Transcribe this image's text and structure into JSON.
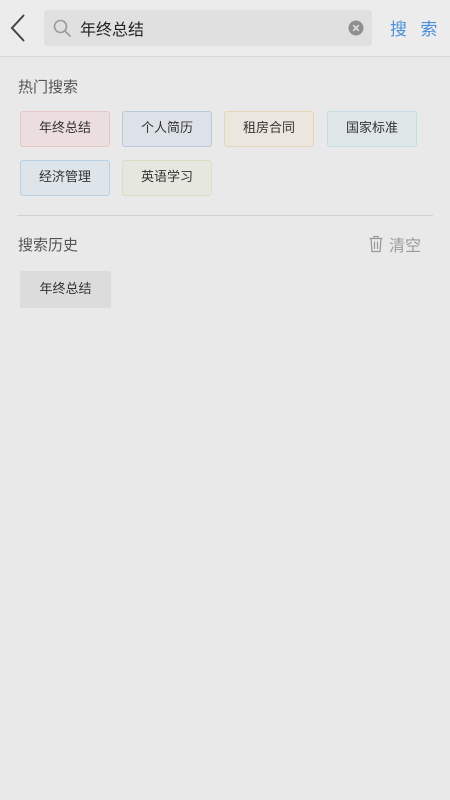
{
  "search": {
    "value": "年终总结",
    "button_label": "搜 索"
  },
  "hot": {
    "title": "热门搜索",
    "tags": [
      {
        "label": "年终总结",
        "bg": "#ecdede",
        "border": "#e6c6c6"
      },
      {
        "label": "个人简历",
        "bg": "#dde2e8",
        "border": "#b9c9dc"
      },
      {
        "label": "租房合同",
        "bg": "#ebe6de",
        "border": "#e6d3b8"
      },
      {
        "label": "国家标准",
        "bg": "#dfe6e8",
        "border": "#c3dde3"
      },
      {
        "label": "经济管理",
        "bg": "#dde4ea",
        "border": "#b8d0e6"
      },
      {
        "label": "英语学习",
        "bg": "#e6e8e0",
        "border": "#d6e0c6"
      }
    ]
  },
  "history": {
    "title": "搜索历史",
    "clear_label": "清空",
    "items": [
      {
        "label": "年终总结"
      }
    ]
  },
  "icons": {
    "back": "chevron-left-icon",
    "search": "search-icon",
    "clear_input": "clear-circle-icon",
    "trash": "trash-icon"
  },
  "colors": {
    "accent": "#4a8fd8",
    "background": "#e9e9e9",
    "muted": "#9a9a9a"
  }
}
